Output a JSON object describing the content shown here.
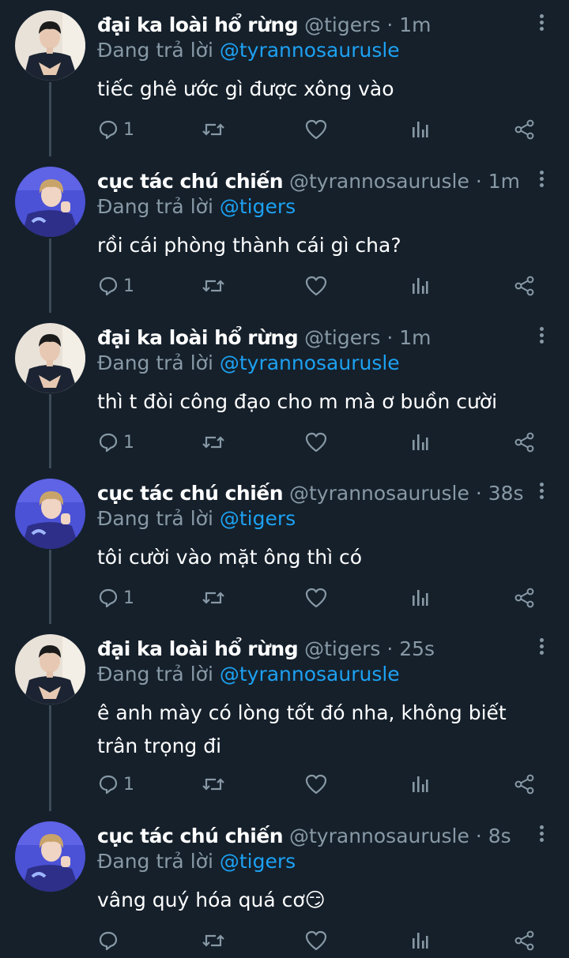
{
  "colors": {
    "background": "#15202b",
    "text_primary": "#ffffff",
    "text_secondary": "#8899a6",
    "mention": "#1da1f2",
    "thread_line": "#3d4b58"
  },
  "labels": {
    "replying_to": "Đang trả lời",
    "dot": "·"
  },
  "tweets": [
    {
      "name": "đại ka loài hổ rừng",
      "handle": "@tigers",
      "time": "1m",
      "reply_to": "@tyrannosaurusle",
      "text": "tiếc ghê ước gì được xông vào",
      "reply_count": "1",
      "avatar_icon": "avatar-photo-dark"
    },
    {
      "name": "cục tác chú chiến",
      "handle": "@tyrannosaurusle",
      "time": "1m",
      "reply_to": "@tigers",
      "text": "rồi cái phòng thành cái gì cha?",
      "reply_count": "1",
      "avatar_icon": "avatar-photo-blue"
    },
    {
      "name": "đại ka loài hổ rừng",
      "handle": "@tigers",
      "time": "1m",
      "reply_to": "@tyrannosaurusle",
      "text": "thì t đòi công đạo cho m mà ơ buồn cười",
      "reply_count": "1",
      "avatar_icon": "avatar-photo-dark"
    },
    {
      "name": "cục tác chú chiến",
      "handle": "@tyrannosaurusle",
      "time": "38s",
      "reply_to": "@tigers",
      "text": "tôi cười vào mặt ông thì có",
      "reply_count": "1",
      "avatar_icon": "avatar-photo-blue"
    },
    {
      "name": "đại ka loài hổ rừng",
      "handle": "@tigers",
      "time": "25s",
      "reply_to": "@tyrannosaurusle",
      "text": "ê anh mày có lòng tốt đó nha, không biết trân trọng đi",
      "reply_count": "1",
      "avatar_icon": "avatar-photo-dark"
    },
    {
      "name": "cục tác chú chiến",
      "handle": "@tyrannosaurusle",
      "time": "8s",
      "reply_to": "@tigers",
      "text": "vâng quý hóa quá cơ😏",
      "reply_count": "",
      "avatar_icon": "avatar-photo-blue"
    }
  ]
}
